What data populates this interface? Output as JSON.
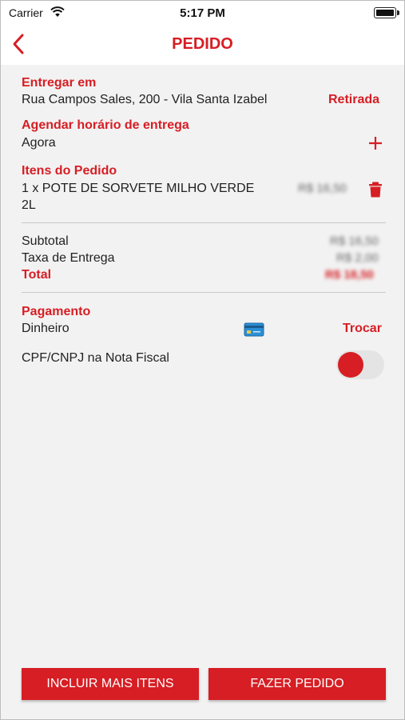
{
  "status_bar": {
    "carrier": "Carrier",
    "time": "5:17 PM"
  },
  "nav": {
    "title": "PEDIDO"
  },
  "delivery": {
    "heading": "Entregar em",
    "address": "Rua Campos Sales, 200 - Vila Santa Izabel",
    "action": "Retirada"
  },
  "schedule": {
    "heading": "Agendar horário de entrega",
    "value": "Agora"
  },
  "items": {
    "heading": "Itens do Pedido",
    "list": [
      {
        "line1": "1 x POTE DE SORVETE MILHO VERDE",
        "line2": "2L",
        "price": "R$ 16,50"
      }
    ]
  },
  "summary": {
    "subtotal_label": "Subtotal",
    "subtotal_value": "R$ 16,50",
    "fee_label": "Taxa de Entrega",
    "fee_value": "R$ 2,00",
    "total_label": "Total",
    "total_value": "R$ 18,50"
  },
  "payment": {
    "heading": "Pagamento",
    "method": "Dinheiro",
    "action": "Trocar"
  },
  "invoice": {
    "label": "CPF/CNPJ na Nota Fiscal"
  },
  "buttons": {
    "more_items": "INCLUIR MAIS ITENS",
    "place_order": "FAZER PEDIDO"
  },
  "colors": {
    "accent": "#d61e24",
    "background": "#f2f2f2"
  }
}
